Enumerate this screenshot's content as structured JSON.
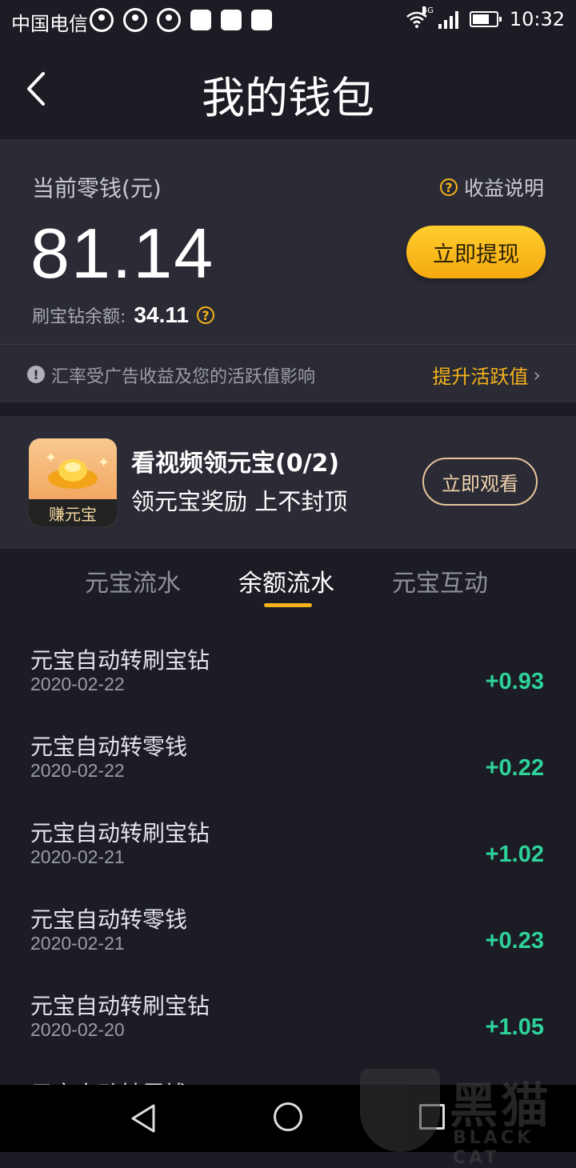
{
  "status_bar": {
    "carrier": "中国电信",
    "network": "4G",
    "time": "10:32"
  },
  "header": {
    "title": "我的钱包"
  },
  "balance": {
    "label": "当前零钱(元)",
    "value": "81.14",
    "earnings_info_label": "收益说明",
    "withdraw_label": "立即提现",
    "diamond_label": "刷宝钻余额:",
    "diamond_value": "34.11"
  },
  "notice": {
    "text": "汇率受广告收益及您的活跃值影响",
    "link_label": "提升活跃值"
  },
  "video_task": {
    "badge_label": "赚元宝",
    "title": "看视频领元宝(0/2)",
    "subtitle": "领元宝奖励 上不封顶",
    "button_label": "立即观看"
  },
  "tabs": [
    {
      "label": "元宝流水",
      "active": false
    },
    {
      "label": "余额流水",
      "active": true
    },
    {
      "label": "元宝互动",
      "active": false
    }
  ],
  "records": [
    {
      "title": "元宝自动转刷宝钻",
      "date": "2020-02-22",
      "amount": "+0.93"
    },
    {
      "title": "元宝自动转零钱",
      "date": "2020-02-22",
      "amount": "+0.22"
    },
    {
      "title": "元宝自动转刷宝钻",
      "date": "2020-02-21",
      "amount": "+1.02"
    },
    {
      "title": "元宝自动转零钱",
      "date": "2020-02-21",
      "amount": "+0.23"
    },
    {
      "title": "元宝自动转刷宝钻",
      "date": "2020-02-20",
      "amount": "+1.05"
    }
  ],
  "partial_record_title": "元宝自动转零钱",
  "watermark": {
    "cn": "黑猫",
    "en": "BLACK CAT"
  },
  "colors": {
    "accent": "#f5b21b",
    "positive": "#2ed39a",
    "background": "#1b1c24",
    "card": "#2a2b35"
  }
}
